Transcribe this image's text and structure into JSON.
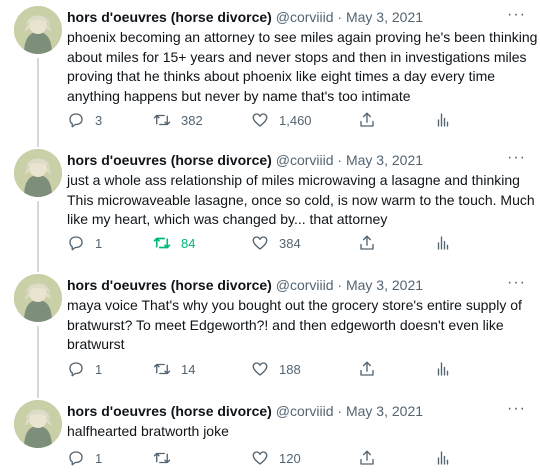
{
  "tweets": [
    {
      "author_name": "hors d'oeuvres (horse divorce)",
      "handle": "@corviiid",
      "separator": "·",
      "date": "May 3, 2021",
      "more": "···",
      "lines": [
        "phoenix becoming an attorney to see miles again proving he's been thinking",
        "about miles for 15+ years and never stops and then in investigations miles",
        "proving that he thinks about phoenix like eight times a day every time",
        "anything happens but never by name that's too intimate"
      ],
      "replies": "3",
      "retweets": "382",
      "likes": "1,460",
      "retweeted": false
    },
    {
      "author_name": "hors d'oeuvres (horse divorce)",
      "handle": "@corviiid",
      "separator": "·",
      "date": "May 3, 2021",
      "more": "···",
      "lines": [
        "just a whole ass relationship of miles microwaving a lasagne and thinking",
        "This microwaveable lasagne, once so cold, is now warm to the touch. Much",
        "like my heart, which was changed by... that attorney"
      ],
      "replies": "1",
      "retweets": "84",
      "likes": "384",
      "retweeted": true
    },
    {
      "author_name": "hors d'oeuvres (horse divorce)",
      "handle": "@corviiid",
      "separator": "·",
      "date": "May 3, 2021",
      "more": "···",
      "lines": [
        "maya voice That's why you bought out the grocery store's entire supply of",
        "bratwurst? To meet Edgeworth?! and then edgeworth doesn't even like",
        "bratwurst"
      ],
      "replies": "1",
      "retweets": "14",
      "likes": "188",
      "retweeted": false
    },
    {
      "author_name": "hors d'oeuvres (horse divorce)",
      "handle": "@corviiid",
      "separator": "·",
      "date": "May 3, 2021",
      "more": "···",
      "lines": [
        "halfhearted bratworth joke"
      ],
      "replies": "1",
      "retweets": "",
      "likes": "120",
      "retweeted": false
    }
  ],
  "colors": {
    "text": "#0f1419",
    "secondary": "#536471",
    "retweet_green": "#00ba7c",
    "thread_line": "#cfd9de"
  },
  "icons": [
    "reply-icon",
    "retweet-icon",
    "like-icon",
    "share-icon",
    "analytics-icon",
    "more-icon"
  ]
}
